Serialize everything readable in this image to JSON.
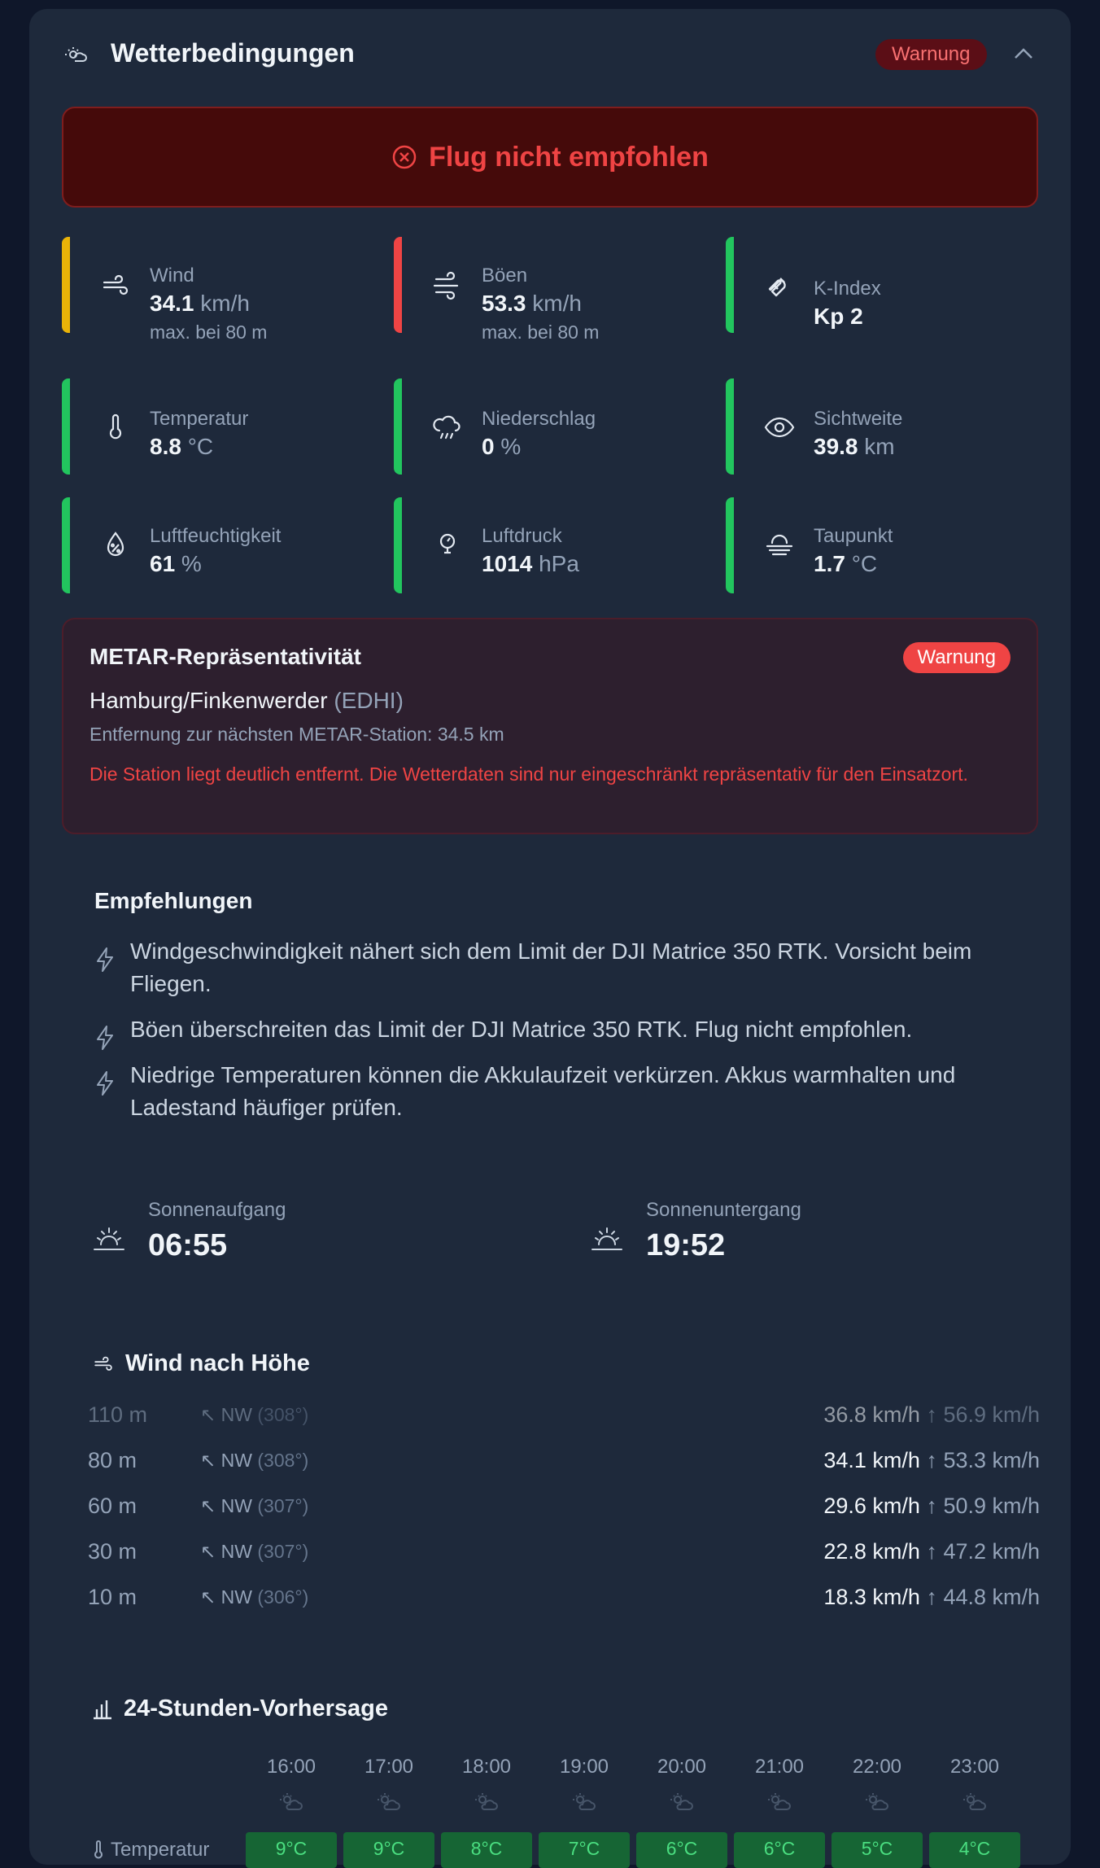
{
  "header": {
    "title": "Wetterbedingungen",
    "badge": "Warnung"
  },
  "alert": {
    "text": "Flug nicht empfohlen"
  },
  "tiles": [
    {
      "label": "Wind",
      "value": "34.1",
      "unit": " km/h",
      "sub": "max. bei 80 m",
      "status": "#eab308"
    },
    {
      "label": "Böen",
      "value": "53.3",
      "unit": " km/h",
      "sub": "max. bei 80 m",
      "status": "#ef4444"
    },
    {
      "label": "K-Index",
      "value": "Kp 2",
      "unit": "",
      "sub": "",
      "status": "#22c55e"
    },
    {
      "label": "Temperatur",
      "value": "8.8",
      "unit": " °C",
      "sub": "",
      "status": "#22c55e"
    },
    {
      "label": "Niederschlag",
      "value": "0",
      "unit": " %",
      "sub": "",
      "status": "#22c55e"
    },
    {
      "label": "Sichtweite",
      "value": "39.8",
      "unit": " km",
      "sub": "",
      "status": "#22c55e"
    },
    {
      "label": "Luftfeuchtigkeit",
      "value": "61",
      "unit": " %",
      "sub": "",
      "status": "#22c55e"
    },
    {
      "label": "Luftdruck",
      "value": "1014",
      "unit": " hPa",
      "sub": "",
      "status": "#22c55e"
    },
    {
      "label": "Taupunkt",
      "value": "1.7",
      "unit": " °C",
      "sub": "",
      "status": "#22c55e"
    }
  ],
  "metar": {
    "title": "METAR-Repräsentativität",
    "badge": "Warnung",
    "station": "Hamburg/Finkenwerder",
    "code": "(EDHI)",
    "distance": "Entfernung zur nächsten METAR-Station: 34.5 km",
    "warning": "Die Station liegt deutlich entfernt. Die Wetterdaten sind nur eingeschränkt repräsentativ für den Einsatzort."
  },
  "recommendations": {
    "title": "Empfehlungen",
    "items": [
      "Windgeschwindigkeit nähert sich dem Limit der DJI Matrice 350 RTK. Vorsicht beim Fliegen.",
      "Böen überschreiten das Limit der DJI Matrice 350 RTK. Flug nicht empfohlen.",
      "Niedrige Temperaturen können die Akkulaufzeit verkürzen. Akkus warmhalten und Ladestand häufiger prüfen."
    ]
  },
  "sun": {
    "sunrise_label": "Sonnenaufgang",
    "sunrise": "06:55",
    "sunset_label": "Sonnenuntergang",
    "sunset": "19:52"
  },
  "wind_height": {
    "title": "Wind nach Höhe",
    "rows": [
      {
        "alt": "110 m",
        "dir": "NW",
        "deg": "(308°)",
        "speed": "36.8 km/h",
        "gust": "↑ 56.9 km/h"
      },
      {
        "alt": "80 m",
        "dir": "NW",
        "deg": "(308°)",
        "speed": "34.1 km/h",
        "gust": "↑ 53.3 km/h"
      },
      {
        "alt": "60 m",
        "dir": "NW",
        "deg": "(307°)",
        "speed": "29.6 km/h",
        "gust": "↑ 50.9 km/h"
      },
      {
        "alt": "30 m",
        "dir": "NW",
        "deg": "(307°)",
        "speed": "22.8 km/h",
        "gust": "↑ 47.2 km/h"
      },
      {
        "alt": "10 m",
        "dir": "NW",
        "deg": "(306°)",
        "speed": "18.3 km/h",
        "gust": "↑ 44.8 km/h"
      }
    ]
  },
  "forecast": {
    "title": "24-Stunden-Vorhersage",
    "hours": [
      "16:00",
      "17:00",
      "18:00",
      "19:00",
      "20:00",
      "21:00",
      "22:00",
      "23:00"
    ],
    "temp_label": "Temperatur",
    "temps": [
      "9°C",
      "9°C",
      "8°C",
      "7°C",
      "6°C",
      "6°C",
      "5°C",
      "4°C"
    ]
  }
}
